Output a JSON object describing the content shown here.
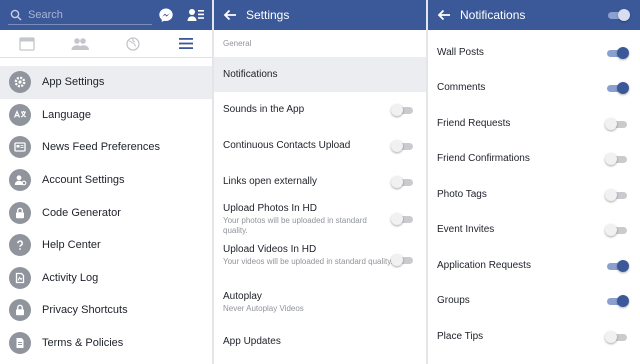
{
  "menu_panel": {
    "search": {
      "placeholder": "Search"
    },
    "menu_items": [
      {
        "label": "App Settings",
        "icon": "gear-icon",
        "active": true
      },
      {
        "label": "Language",
        "icon": "translate-icon",
        "active": false
      },
      {
        "label": "News Feed Preferences",
        "icon": "feed-icon",
        "active": false
      },
      {
        "label": "Account Settings",
        "icon": "account-icon",
        "active": false
      },
      {
        "label": "Code Generator",
        "icon": "lock-icon",
        "active": false
      },
      {
        "label": "Help Center",
        "icon": "help-icon",
        "active": false
      },
      {
        "label": "Activity Log",
        "icon": "activity-icon",
        "active": false
      },
      {
        "label": "Privacy Shortcuts",
        "icon": "privacy-lock-icon",
        "active": false
      },
      {
        "label": "Terms & Policies",
        "icon": "terms-icon",
        "active": false
      }
    ]
  },
  "settings_panel": {
    "title": "Settings",
    "section_label": "General",
    "rows": [
      {
        "title": "Notifications",
        "subtitle": "",
        "toggle": null,
        "active": true
      },
      {
        "title": "Sounds in the App",
        "subtitle": "",
        "toggle": false,
        "active": false
      },
      {
        "title": "Continuous Contacts Upload",
        "subtitle": "",
        "toggle": false,
        "active": false
      },
      {
        "title": "Links open externally",
        "subtitle": "",
        "toggle": false,
        "active": false
      },
      {
        "title": "Upload Photos In HD",
        "subtitle": "Your photos will be uploaded in standard quality.",
        "toggle": false,
        "active": false
      },
      {
        "title": "Upload Videos In HD",
        "subtitle": "Your videos will be uploaded in standard quality.",
        "toggle": false,
        "active": false
      },
      {
        "title": "Autoplay",
        "subtitle": "Never Autoplay Videos",
        "toggle": null,
        "active": false
      },
      {
        "title": "App Updates",
        "subtitle": "",
        "toggle": null,
        "active": false
      }
    ]
  },
  "notifications_panel": {
    "title": "Notifications",
    "master_toggle": true,
    "rows": [
      {
        "title": "Wall Posts",
        "toggle": true
      },
      {
        "title": "Comments",
        "toggle": true
      },
      {
        "title": "Friend Requests",
        "toggle": false
      },
      {
        "title": "Friend Confirmations",
        "toggle": false
      },
      {
        "title": "Photo Tags",
        "toggle": false
      },
      {
        "title": "Event Invites",
        "toggle": false
      },
      {
        "title": "Application Requests",
        "toggle": true
      },
      {
        "title": "Groups",
        "toggle": true
      },
      {
        "title": "Place Tips",
        "toggle": false
      }
    ]
  },
  "colors": {
    "brand_blue": "#3b5998",
    "toggle_on_track": "#8ba0cf",
    "toggle_off_track": "#c9cbcf",
    "active_row_bg": "#ebedf0",
    "icon_gray": "#90949c"
  }
}
